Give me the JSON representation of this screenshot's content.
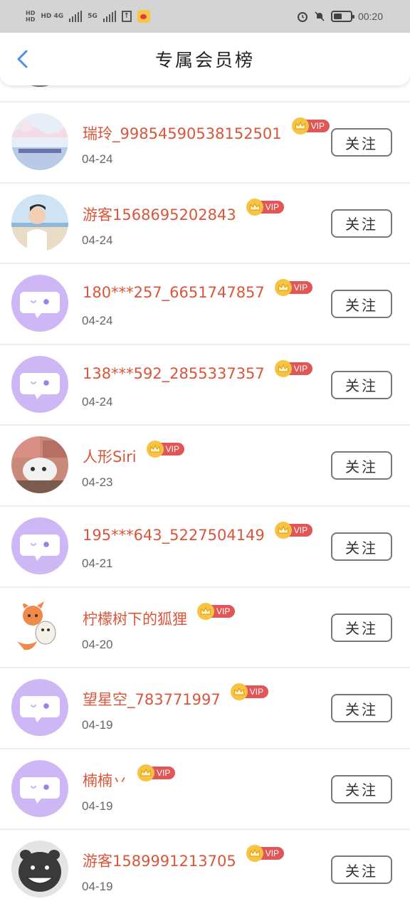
{
  "status_bar": {
    "network_left": "HD 4G",
    "network_right": "5G",
    "time": "00:20",
    "battery_percent": 50
  },
  "header": {
    "title": "专属会员榜",
    "back_icon": "chevron-left-icon"
  },
  "colors": {
    "accent": "#4a90e2",
    "username": "#d9563a",
    "vip_badge": "#e15757",
    "crown": "#f6c343",
    "default_avatar": "#cdb8f5"
  },
  "members": [
    {
      "name": "瑞玲_99854590538152501",
      "date": "04-24",
      "vip": "VIP",
      "follow": "关注",
      "avatar": "landscape"
    },
    {
      "name": "游客1568695202843",
      "date": "04-24",
      "vip": "VIP",
      "follow": "关注",
      "avatar": "beach-person"
    },
    {
      "name": "180***257_6651747857",
      "date": "04-24",
      "vip": "VIP",
      "follow": "关注",
      "avatar": "default"
    },
    {
      "name": "138***592_2855337357",
      "date": "04-24",
      "vip": "VIP",
      "follow": "关注",
      "avatar": "default"
    },
    {
      "name": "人形Siri",
      "date": "04-23",
      "vip": "VIP",
      "follow": "关注",
      "avatar": "cat-money"
    },
    {
      "name": "195***643_5227504149",
      "date": "04-21",
      "vip": "VIP",
      "follow": "关注",
      "avatar": "default"
    },
    {
      "name": "柠檬树下的狐狸",
      "date": "04-20",
      "vip": "VIP",
      "follow": "关注",
      "avatar": "fox-cartoon"
    },
    {
      "name": "望星空_783771997",
      "date": "04-19",
      "vip": "VIP",
      "follow": "关注",
      "avatar": "default"
    },
    {
      "name": "楠楠丷",
      "date": "04-19",
      "vip": "VIP",
      "follow": "关注",
      "avatar": "default"
    },
    {
      "name": "游客1589991213705",
      "date": "04-19",
      "vip": "VIP",
      "follow": "关注",
      "avatar": "grinning-face"
    }
  ]
}
